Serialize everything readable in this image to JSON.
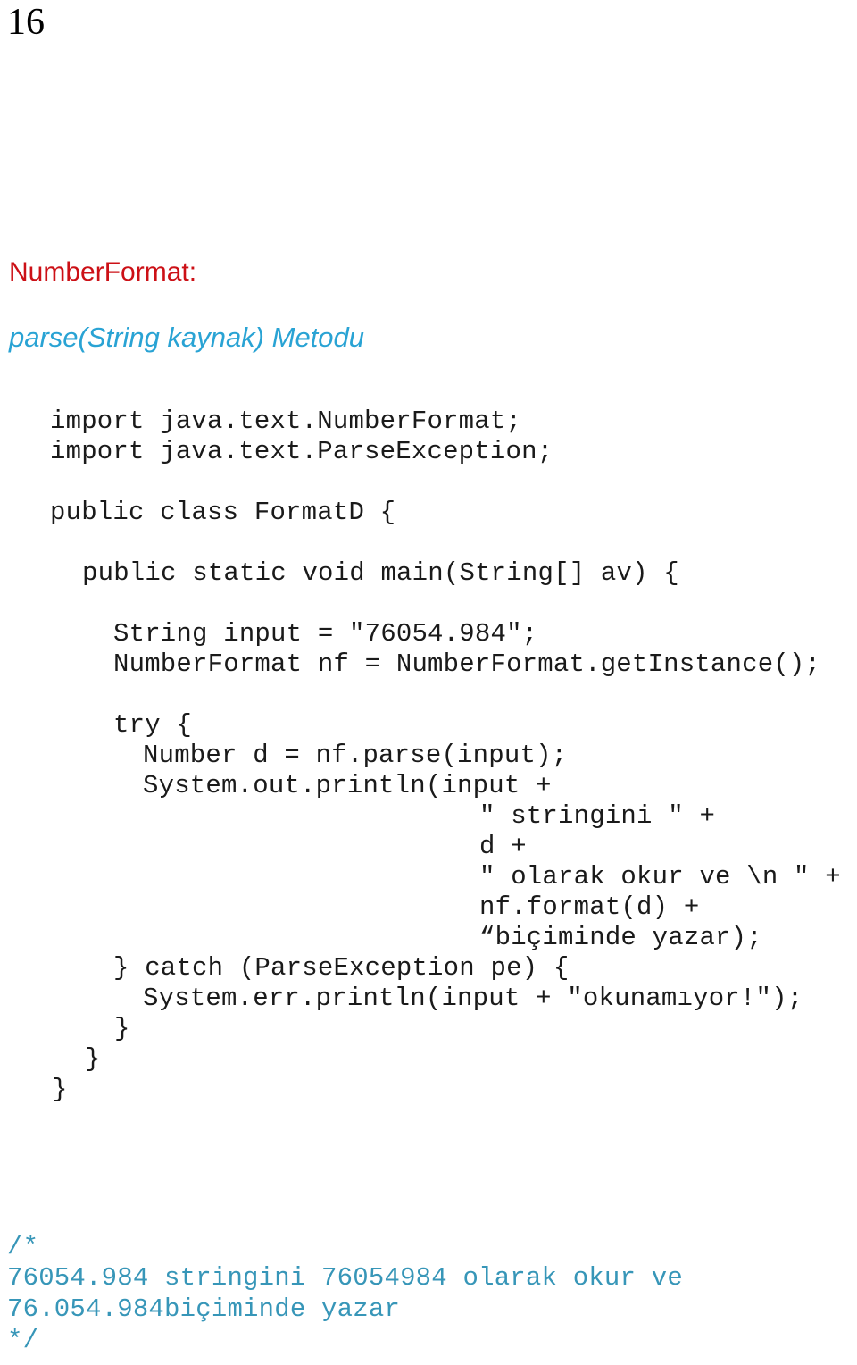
{
  "page": {
    "number": "16",
    "background_color": "#ffffff"
  },
  "colors": {
    "heading_red": "#cc1016",
    "subtitle_cyan": "#29a3d4",
    "code_black": "#1a1a1a",
    "comment_cyan": "#3796b8"
  },
  "title": {
    "main": "NumberFormat:",
    "sub": "parse(String kaynak) Metodu"
  },
  "code": {
    "lines": [
      {
        "text": "import java.text.NumberFormat;",
        "indent": "ind-0"
      },
      {
        "text": "import java.text.ParseException;",
        "indent": "ind-0"
      },
      {
        "text": "",
        "indent": "ind-0"
      },
      {
        "text": "public class FormatD {",
        "indent": "ind-0"
      },
      {
        "text": "",
        "indent": "ind-0"
      },
      {
        "text": "public static void main(String[] av) {",
        "indent": "ind-1"
      },
      {
        "text": "",
        "indent": "ind-0"
      },
      {
        "text": "String input = \"76054.984\";",
        "indent": "ind-2"
      },
      {
        "text": "NumberFormat nf = NumberFormat.getInstance();",
        "indent": "ind-2"
      },
      {
        "text": "",
        "indent": "ind-0"
      },
      {
        "text": "try {",
        "indent": "ind-2"
      },
      {
        "text": "Number d = nf.parse(input);",
        "indent": "ind-3"
      },
      {
        "text": "System.out.println(input +",
        "indent": "ind-3"
      },
      {
        "text": "\" stringini \" +",
        "indent": "ind-deep"
      },
      {
        "text": "d +",
        "indent": "ind-deep"
      },
      {
        "text": "\" olarak okur ve \\n \" +",
        "indent": "ind-deep"
      },
      {
        "text": "nf.format(d) +",
        "indent": "ind-deep"
      },
      {
        "text": "“biçiminde yazar);",
        "indent": "ind-deep"
      },
      {
        "text": "} catch (ParseException pe) {",
        "indent": "ind-2"
      },
      {
        "text": "System.err.println(input + \"okunamıyor!\");",
        "indent": "ind-3"
      },
      {
        "text": "}",
        "indent": "ind-close-2"
      },
      {
        "text": "}",
        "indent": "ind-close-1"
      },
      {
        "text": "}",
        "indent": "ind-close-0"
      }
    ]
  },
  "comment": {
    "lines": [
      "/*",
      "76054.984 stringini 76054984 olarak okur ve",
      "76.054.984biçiminde yazar",
      "*/"
    ]
  }
}
